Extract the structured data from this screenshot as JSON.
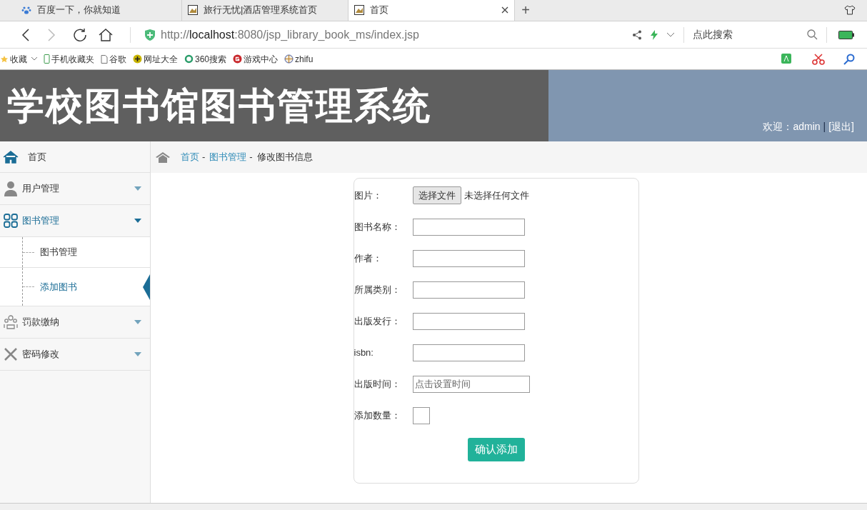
{
  "browser": {
    "tabs": [
      {
        "title": "百度一下，你就知道",
        "selected": false
      },
      {
        "title": "旅行无忧|酒店管理系统首页",
        "selected": false
      },
      {
        "title": "首页",
        "selected": true
      }
    ],
    "new_tab": "+",
    "url": {
      "scheme": "http://",
      "host": "localhost",
      "rest": ":8080/jsp_library_book_ms/index.jsp"
    },
    "search": {
      "placeholder": "点此搜索"
    },
    "bookmarks": [
      {
        "label": "收藏"
      },
      {
        "label": "手机收藏夹"
      },
      {
        "label": "谷歌"
      },
      {
        "label": "网址大全"
      },
      {
        "label": "360搜索"
      },
      {
        "label": "游戏中心"
      },
      {
        "label": "zhifu"
      }
    ]
  },
  "header": {
    "title": "学校图书馆图书管理系统",
    "welcome": "欢迎：",
    "user": "admin",
    "separator": "|",
    "logout": "[退出]"
  },
  "sidebar": {
    "items": [
      {
        "label": "首页",
        "selected": false
      },
      {
        "label": "用户管理",
        "expanded": false,
        "selected": false
      },
      {
        "label": "图书管理",
        "expanded": true,
        "selected": true,
        "children": [
          {
            "label": "图书管理",
            "selected": false
          },
          {
            "label": "添加图书",
            "selected": true
          }
        ]
      },
      {
        "label": "罚款缴纳",
        "expanded": false,
        "selected": false
      },
      {
        "label": "密码修改",
        "expanded": false,
        "selected": false
      }
    ]
  },
  "breadcrumb": {
    "separator": "-",
    "items": [
      {
        "label": "首页",
        "kind": "link"
      },
      {
        "label": "图书管理",
        "kind": "link"
      },
      {
        "label": "修改图书信息",
        "kind": "current"
      }
    ]
  },
  "form": {
    "fields": [
      {
        "label": "图片：",
        "kind": "file",
        "button": "选择文件",
        "status": "未选择任何文件"
      },
      {
        "label": "图书名称：",
        "kind": "text"
      },
      {
        "label": "作者：",
        "kind": "text"
      },
      {
        "label": "所属类别：",
        "kind": "text"
      },
      {
        "label": "出版发行：",
        "kind": "text"
      },
      {
        "label": "isbn:",
        "kind": "text"
      },
      {
        "label": "出版时间：",
        "kind": "date",
        "placeholder": "点击设置时间"
      },
      {
        "label": "添加数量：",
        "kind": "number"
      }
    ],
    "submit": "确认添加"
  }
}
